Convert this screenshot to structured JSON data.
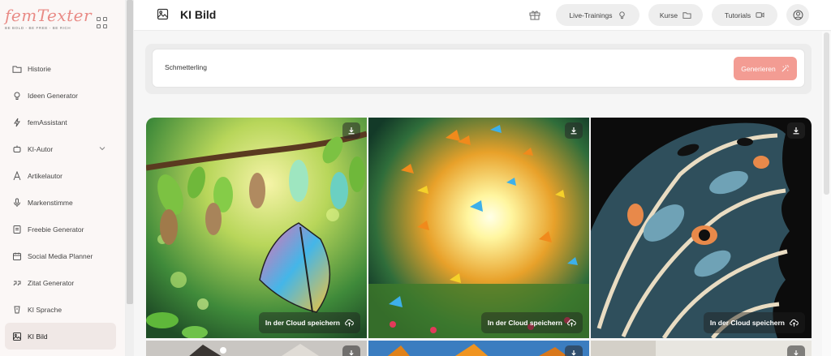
{
  "brand": {
    "name": "femTexter",
    "tagline": "BE BOLD - BE FREE - BE RICH"
  },
  "sidebar": {
    "items": [
      {
        "label": "Historie",
        "icon": "folder-icon"
      },
      {
        "label": "Ideen Generator",
        "icon": "lightbulb-icon"
      },
      {
        "label": "femAssistant",
        "icon": "bolt-icon"
      },
      {
        "label": "KI-Autor",
        "icon": "robot-icon"
      },
      {
        "label": "Artikelautor",
        "icon": "font-icon"
      },
      {
        "label": "Markenstimme",
        "icon": "microphone-icon"
      },
      {
        "label": "Freebie Generator",
        "icon": "document-icon"
      },
      {
        "label": "Social Media Planner",
        "icon": "calendar-icon"
      },
      {
        "label": "Zitat Generator",
        "icon": "quote-icon"
      },
      {
        "label": "KI Sprache",
        "icon": "speech-icon"
      },
      {
        "label": "KI Bild",
        "icon": "image-icon"
      }
    ]
  },
  "header": {
    "title": "KI Bild",
    "live_label": "Live-Trainings",
    "kurse_label": "Kurse",
    "tutorials_label": "Tutorials"
  },
  "prompt": {
    "value": "Schmetterling",
    "generate_label": "Generieren"
  },
  "gallery": {
    "cloud_label": "In der Cloud speichern",
    "images": [
      {
        "subject": "butterfly emerging from chrysalis on branch"
      },
      {
        "subject": "many butterflies flying toward bright light over meadow"
      },
      {
        "subject": "close-up of butterfly wing pattern"
      }
    ]
  },
  "colors": {
    "accent": "#f39c93",
    "brand": "#e98b86"
  }
}
